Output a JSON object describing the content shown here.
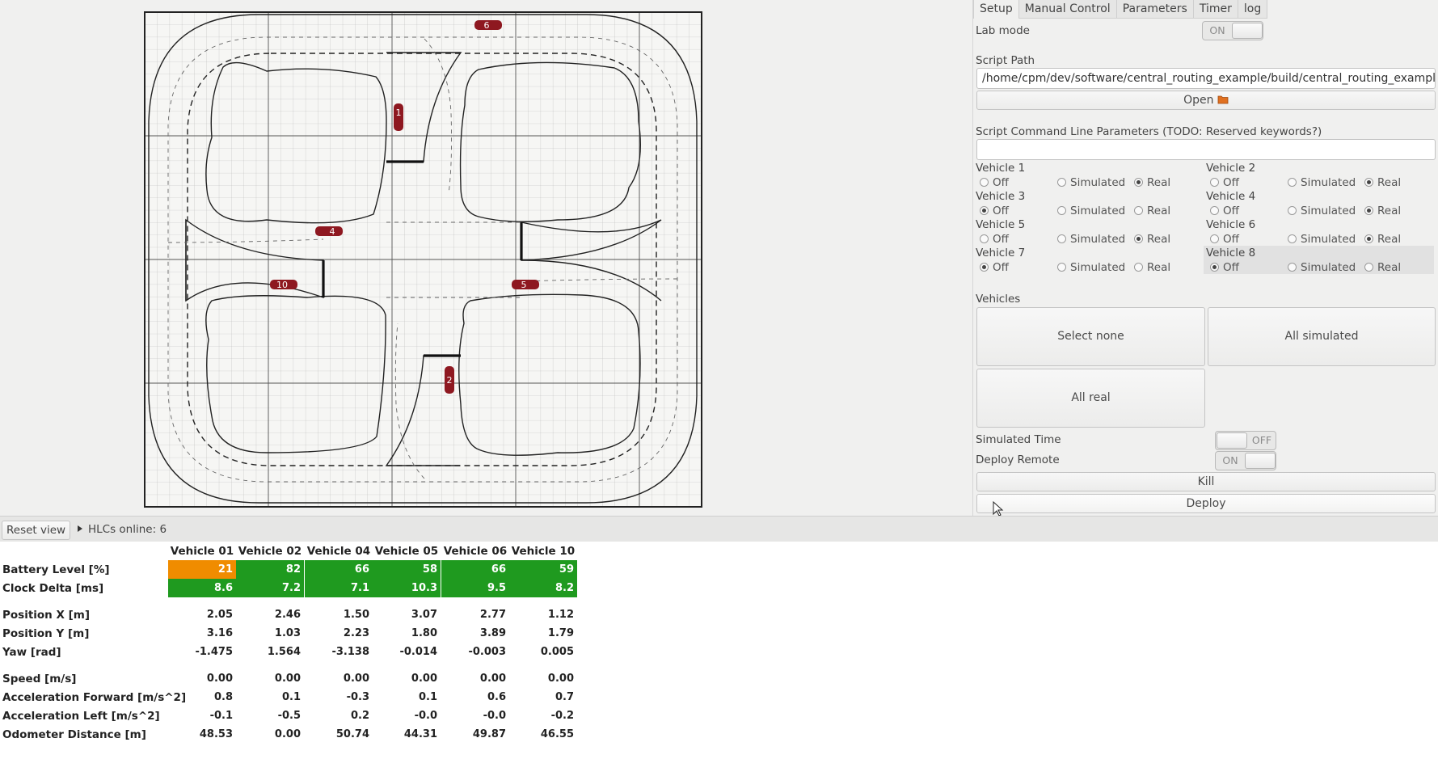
{
  "tabs": [
    "Setup",
    "Manual Control",
    "Parameters",
    "Timer",
    "log"
  ],
  "setup": {
    "lab_mode_label": "Lab mode",
    "lab_mode_switch": "ON",
    "script_path_label": "Script Path",
    "script_path_value": "/home/cpm/dev/software/central_routing_example/build/central_routing_example",
    "open_button": "Open",
    "cmd_params_label": "Script Command Line Parameters (TODO: Reserved keywords?)",
    "cmd_params_value": "",
    "radio_labels": {
      "off": "Off",
      "simulated": "Simulated",
      "real": "Real"
    },
    "vehicles": [
      {
        "name": "Vehicle 1",
        "mode": "real"
      },
      {
        "name": "Vehicle 2",
        "mode": "real"
      },
      {
        "name": "Vehicle 3",
        "mode": "off"
      },
      {
        "name": "Vehicle 4",
        "mode": "real"
      },
      {
        "name": "Vehicle 5",
        "mode": "real"
      },
      {
        "name": "Vehicle 6",
        "mode": "real"
      },
      {
        "name": "Vehicle 7",
        "mode": "off"
      },
      {
        "name": "Vehicle 8",
        "mode": "off"
      }
    ],
    "vehicles_label": "Vehicles",
    "select_none": "Select none",
    "all_simulated": "All simulated",
    "all_real": "All real",
    "simulated_time_label": "Simulated Time",
    "simulated_time_switch": "OFF",
    "deploy_remote_label": "Deploy Remote",
    "deploy_remote_switch": "ON",
    "kill_button": "Kill",
    "deploy_button": "Deploy"
  },
  "map": {
    "vehicles_on_track": [
      "6",
      "1",
      "4",
      "10",
      "5",
      "2"
    ]
  },
  "strip": {
    "reset_view": "Reset view",
    "hlcs_online": "HLCs online: 6"
  },
  "table": {
    "columns": [
      "Vehicle 01",
      "Vehicle 02",
      "Vehicle 04",
      "Vehicle 05",
      "Vehicle 06",
      "Vehicle 10"
    ],
    "rows": [
      {
        "label": "Battery Level [%]",
        "values": [
          "21",
          "82",
          "66",
          "58",
          "66",
          "59"
        ],
        "colors": [
          "#f08c00",
          "#1f9a1f",
          "#1f9a1f",
          "#1f9a1f",
          "#1f9a1f",
          "#1f9a1f"
        ]
      },
      {
        "label": "Clock Delta [ms]",
        "values": [
          "8.6",
          "7.2",
          "7.1",
          "10.3",
          "9.5",
          "8.2"
        ],
        "colors": [
          "#1f9a1f",
          "#1f9a1f",
          "#1f9a1f",
          "#1f9a1f",
          "#1f9a1f",
          "#1f9a1f"
        ]
      },
      {
        "label": "Position X [m]",
        "values": [
          "2.05",
          "2.46",
          "1.50",
          "3.07",
          "2.77",
          "1.12"
        ]
      },
      {
        "label": "Position Y [m]",
        "values": [
          "3.16",
          "1.03",
          "2.23",
          "1.80",
          "3.89",
          "1.79"
        ]
      },
      {
        "label": "Yaw [rad]",
        "values": [
          "-1.475",
          "1.564",
          "-3.138",
          "-0.014",
          "-0.003",
          "0.005"
        ]
      },
      {
        "label": "Speed [m/s]",
        "values": [
          "0.00",
          "0.00",
          "0.00",
          "0.00",
          "0.00",
          "0.00"
        ]
      },
      {
        "label": "Acceleration Forward [m/s^2]",
        "values": [
          "0.8",
          "0.1",
          "-0.3",
          "0.1",
          "0.6",
          "0.7"
        ]
      },
      {
        "label": "Acceleration Left [m/s^2]",
        "values": [
          "-0.1",
          "-0.5",
          "0.2",
          "-0.0",
          "-0.0",
          "-0.2"
        ]
      },
      {
        "label": "Odometer Distance [m]",
        "values": [
          "48.53",
          "0.00",
          "50.74",
          "44.31",
          "49.87",
          "46.55"
        ]
      }
    ]
  }
}
